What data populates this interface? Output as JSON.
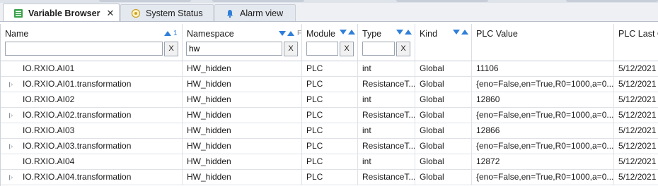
{
  "tabs": [
    {
      "label": "Variable Browser",
      "icon": "variable-browser-icon",
      "active": true,
      "close": "✕"
    },
    {
      "label": "System Status",
      "icon": "system-status-icon",
      "active": false
    },
    {
      "label": "Alarm view",
      "icon": "alarm-bell-icon",
      "active": false
    }
  ],
  "columns": {
    "name": {
      "label": "Name",
      "sort_index": "1"
    },
    "namespace": {
      "label": "Namespace",
      "extra": "F"
    },
    "module": {
      "label": "Module"
    },
    "type": {
      "label": "Type"
    },
    "kind": {
      "label": "Kind"
    },
    "plc_value": {
      "label": "PLC Value"
    },
    "plc_last": {
      "label": "PLC Last Co"
    }
  },
  "filters": {
    "name": "",
    "namespace": "hw",
    "module": "",
    "type": "",
    "clear_label": "X"
  },
  "rows": [
    {
      "name": "IO.RXIO.AI01",
      "namespace": "HW_hidden",
      "module": "PLC",
      "type": "int",
      "kind": "Global",
      "value": "11106",
      "last": "5/12/2021",
      "expandable": false
    },
    {
      "name": "IO.RXIO.AI01.transformation",
      "namespace": "HW_hidden",
      "module": "PLC",
      "type": "ResistanceT...",
      "kind": "Global",
      "value": "{eno=False,en=True,R0=1000,a=0...",
      "last": "5/12/2021",
      "expandable": true
    },
    {
      "name": "IO.RXIO.AI02",
      "namespace": "HW_hidden",
      "module": "PLC",
      "type": "int",
      "kind": "Global",
      "value": "12860",
      "last": "5/12/2021",
      "expandable": false
    },
    {
      "name": "IO.RXIO.AI02.transformation",
      "namespace": "HW_hidden",
      "module": "PLC",
      "type": "ResistanceT...",
      "kind": "Global",
      "value": "{eno=False,en=True,R0=1000,a=0...",
      "last": "5/12/2021",
      "expandable": true
    },
    {
      "name": "IO.RXIO.AI03",
      "namespace": "HW_hidden",
      "module": "PLC",
      "type": "int",
      "kind": "Global",
      "value": "12866",
      "last": "5/12/2021",
      "expandable": false
    },
    {
      "name": "IO.RXIO.AI03.transformation",
      "namespace": "HW_hidden",
      "module": "PLC",
      "type": "ResistanceT...",
      "kind": "Global",
      "value": "{eno=False,en=True,R0=1000,a=0...",
      "last": "5/12/2021",
      "expandable": true
    },
    {
      "name": "IO.RXIO.AI04",
      "namespace": "HW_hidden",
      "module": "PLC",
      "type": "int",
      "kind": "Global",
      "value": "12872",
      "last": "5/12/2021",
      "expandable": false
    },
    {
      "name": "IO.RXIO.AI04.transformation",
      "namespace": "HW_hidden",
      "module": "PLC",
      "type": "ResistanceT...",
      "kind": "Global",
      "value": "{eno=False,en=True,R0=1000,a=0...",
      "last": "5/12/2021",
      "expandable": true
    }
  ],
  "colors": {
    "accent": "#2f7fd9",
    "tab_icon_green": "#3aa24a",
    "bell_blue": "#2f7fd9"
  }
}
